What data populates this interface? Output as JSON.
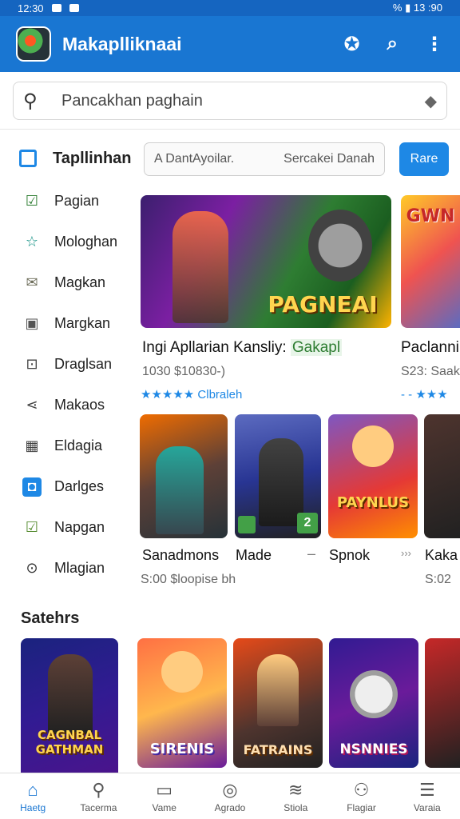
{
  "status_bar": {
    "time": "12:30",
    "right_text": "% ▮ 13 :90"
  },
  "app_bar": {
    "title": "Makaplliknaai"
  },
  "search": {
    "placeholder": "Pancakhan paghain"
  },
  "sidebar": {
    "header": "Tapllinhan",
    "items": [
      {
        "label": "Pagian",
        "icon": "check-box-icon",
        "color": "#2e7d32"
      },
      {
        "label": "Mologhan",
        "icon": "star-outline-icon",
        "color": "#00897b"
      },
      {
        "label": "Magkan",
        "icon": "envelope-icon",
        "color": "#6d6d5a"
      },
      {
        "label": "Margkan",
        "icon": "box-icon",
        "color": "#555555"
      },
      {
        "label": "Draglsan",
        "icon": "square-dot-icon",
        "color": "#444444"
      },
      {
        "label": "Makaos",
        "icon": "share-icon",
        "color": "#444444"
      },
      {
        "label": "Eldagia",
        "icon": "grid-icon",
        "color": "#444444"
      },
      {
        "label": "Darlges",
        "icon": "chat-bubble-icon",
        "color": "#1e88e5"
      },
      {
        "label": "Napgan",
        "icon": "check-square-icon",
        "color": "#558b2f"
      },
      {
        "label": "Mlagian",
        "icon": "record-icon",
        "color": "#333333"
      }
    ]
  },
  "filters": {
    "left": "A  DantAyoilar.",
    "right": "Sercakei Danah",
    "button": "Rare"
  },
  "featured": [
    {
      "title_main": "Ingi Apllarian Kansliy:",
      "title_accent": "Gakapl",
      "sub": "1030  $10830-)",
      "stars": "★★★★★",
      "star_text": "Clbraleh",
      "art_text": "PAGNEAI"
    },
    {
      "title_main": "Paclanni",
      "title_accent": "",
      "sub": "S23: Saak",
      "stars": "- -  ★★★",
      "star_text": "",
      "art_text": "GWN"
    }
  ],
  "tiles": [
    {
      "title": "Sanadmons",
      "sub": "S:00  $loopise bh",
      "art_text": ""
    },
    {
      "title": "Made",
      "sub": "",
      "art_text": ""
    },
    {
      "title": "Spnok",
      "sub": "",
      "art_text": "PAYNLUS"
    },
    {
      "title": "Kaka",
      "sub": "S:02",
      "art_text": ""
    }
  ],
  "tile_separators": [
    "–",
    "›››"
  ],
  "section": {
    "title": "Satehrs"
  },
  "bottom_row": [
    {
      "art_text": "CAGNBAL GATHMAN"
    },
    {
      "art_text": "SIRENIS"
    },
    {
      "art_text": "FATRAINS"
    },
    {
      "art_text": "NSNNIES"
    },
    {
      "art_text": ""
    }
  ],
  "bottom_nav": [
    {
      "label": "Haetg",
      "icon": "home-icon"
    },
    {
      "label": "Tacerma",
      "icon": "search-icon"
    },
    {
      "label": "Vame",
      "icon": "window-icon"
    },
    {
      "label": "Agrado",
      "icon": "compass-icon"
    },
    {
      "label": "Stiola",
      "icon": "stack-icon"
    },
    {
      "label": "Flagiar",
      "icon": "people-icon"
    },
    {
      "label": "Varaia",
      "icon": "menu-icon"
    }
  ]
}
